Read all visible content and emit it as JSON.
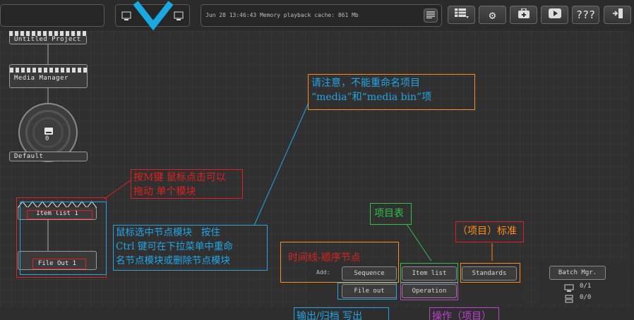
{
  "status": {
    "text": "Jun 28 13:46:43 Memory playback cache: 861 Mb"
  },
  "toolbar": {
    "help_label": "???"
  },
  "nodes": {
    "project": "Untitled Project",
    "media_manager": "Media Manager",
    "storage_count": "0",
    "default": "Default",
    "item_list": "Item list 1",
    "file_out": "File Out 1"
  },
  "add_panel": {
    "label": "Add:",
    "sequence": "Sequence",
    "item_list": "Item list",
    "standards": "Standards",
    "file_out": "File out",
    "operation": "Operation"
  },
  "batch": {
    "label": "Batch Mgr.",
    "count1": "0/1",
    "count2": "0/0"
  },
  "annotations": {
    "rename_note_l1": "请注意，不能重命名项目",
    "rename_note_l2": "“media”和“media bin”项",
    "drag_note_l1": "按M键 鼠标点击可以",
    "drag_note_l2": "拖动 单个模块",
    "select_note_l1": "鼠标选中节点模块   按住",
    "select_note_l2": "Ctrl 键可在下拉菜单中重命",
    "select_note_l3": "名节点模块或删除节点模块",
    "item_table": "项目表",
    "standard": "（项目）标准",
    "timeline": "时间线-顺序节点",
    "output": "输出/归档  写出",
    "operation": "操作（项目）"
  },
  "colors": {
    "orange": "#ff8c1a",
    "red": "#e02020",
    "blue": "#22a6e8",
    "green": "#2ec04a",
    "purple": "#c040d0",
    "logo": "#1aa8e0"
  }
}
